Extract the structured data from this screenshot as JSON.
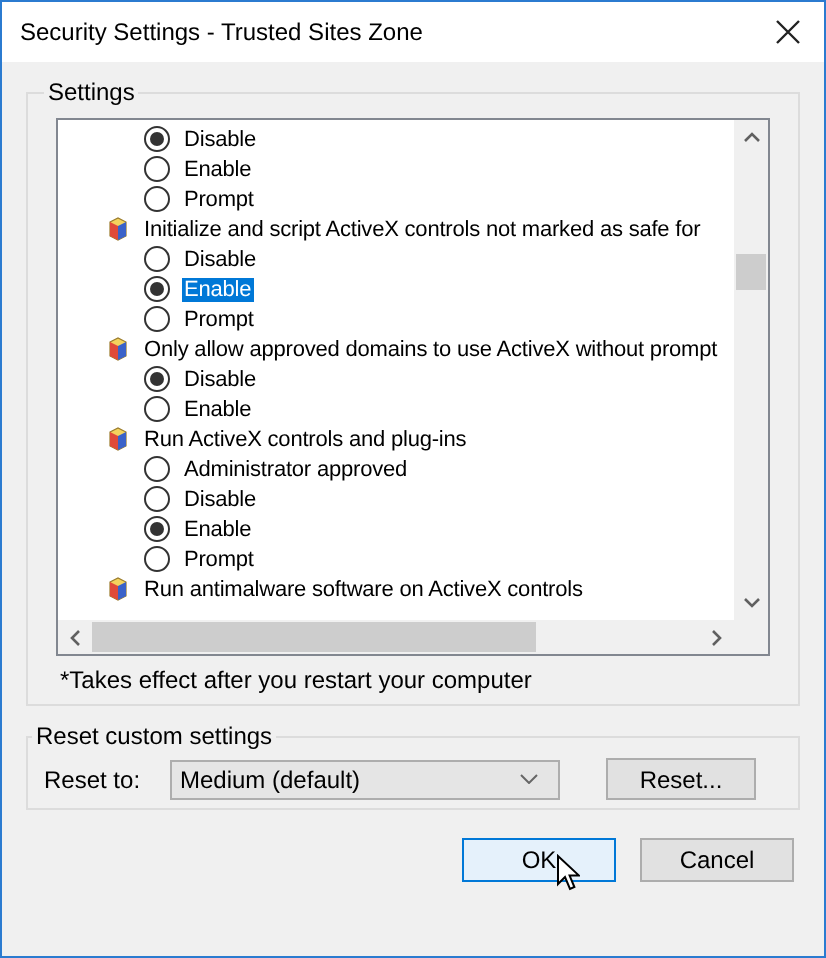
{
  "window": {
    "title": "Security Settings - Trusted Sites Zone"
  },
  "settings": {
    "label": "Settings",
    "groups": [
      {
        "options": [
          {
            "label": "Disable",
            "selected": true,
            "focused": false
          },
          {
            "label": "Enable",
            "selected": false,
            "focused": false
          },
          {
            "label": "Prompt",
            "selected": false,
            "focused": false
          }
        ]
      },
      {
        "title": "Initialize and script ActiveX controls not marked as safe for",
        "options": [
          {
            "label": "Disable",
            "selected": false,
            "focused": false
          },
          {
            "label": "Enable",
            "selected": true,
            "focused": true
          },
          {
            "label": "Prompt",
            "selected": false,
            "focused": false
          }
        ]
      },
      {
        "title": "Only allow approved domains to use ActiveX without prompt",
        "options": [
          {
            "label": "Disable",
            "selected": true,
            "focused": false
          },
          {
            "label": "Enable",
            "selected": false,
            "focused": false
          }
        ]
      },
      {
        "title": "Run ActiveX controls and plug-ins",
        "options": [
          {
            "label": "Administrator approved",
            "selected": false,
            "focused": false
          },
          {
            "label": "Disable",
            "selected": false,
            "focused": false
          },
          {
            "label": "Enable",
            "selected": true,
            "focused": false
          },
          {
            "label": "Prompt",
            "selected": false,
            "focused": false
          }
        ]
      },
      {
        "title": "Run antimalware software on ActiveX controls"
      }
    ],
    "note": "*Takes effect after you restart your computer"
  },
  "reset": {
    "label": "Reset custom settings",
    "field_label": "Reset to:",
    "value": "Medium (default)",
    "button": "Reset..."
  },
  "buttons": [
    {
      "label": "OK",
      "default": true
    },
    {
      "label": "Cancel",
      "default": false
    }
  ]
}
